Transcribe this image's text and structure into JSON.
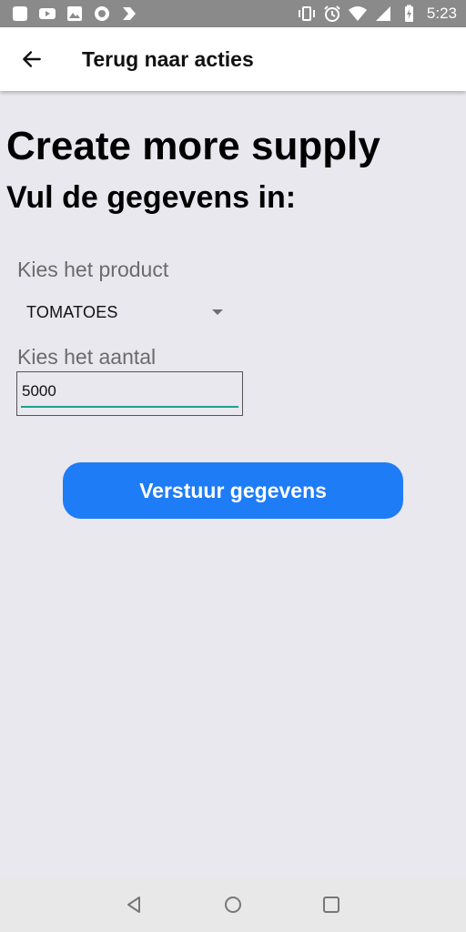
{
  "status_bar": {
    "time": "5:23",
    "left_icons": [
      "square-icon",
      "youtube-icon",
      "image-icon",
      "circle-app-icon",
      "tasks-icon"
    ],
    "right_icons": [
      "vibrate-icon",
      "alarm-icon",
      "wifi-icon",
      "signal-icon",
      "battery-charging-icon"
    ]
  },
  "app_bar": {
    "back_icon": "arrow-left-icon",
    "title": "Terug naar acties"
  },
  "main": {
    "heading": "Create more supply",
    "subheading": "Vul de gegevens in:",
    "product_label": "Kies het product",
    "product_selected": "TOMATOES",
    "amount_label": "Kies het aantal",
    "amount_value": "5000",
    "submit_label": "Verstuur gegevens"
  },
  "colors": {
    "background": "#e9e8ee",
    "accent": "#1f7cf7",
    "input_underline": "#1aa28f"
  },
  "nav_bar": {
    "items": [
      "back-triangle-icon",
      "home-circle-icon",
      "recents-square-icon"
    ]
  }
}
